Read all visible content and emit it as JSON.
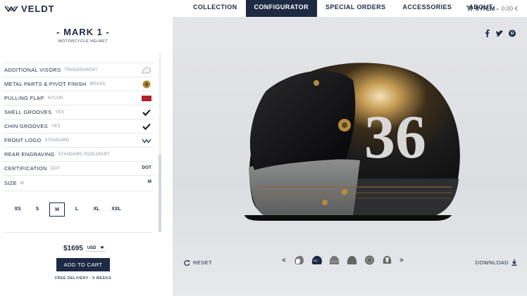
{
  "brand": {
    "name": "VELDT",
    "icon": "veldt-logo-icon"
  },
  "nav": {
    "items": [
      {
        "label": "COLLECTION",
        "active": false
      },
      {
        "label": "CONFIGURATOR",
        "active": true
      },
      {
        "label": "SPECIAL ORDERS",
        "active": false
      },
      {
        "label": "ACCESSORIES",
        "active": false
      },
      {
        "label": "ABOUT",
        "active": false
      }
    ],
    "cart_label": "0 ITEM -",
    "cart_price": "0,00 €",
    "cart_icon": "shopping-cart-icon"
  },
  "product": {
    "title": "- MARK 1 -",
    "subtitle": "MOTORCYCLE HELMET"
  },
  "options": [
    {
      "name": "ADDITIONAL VISORS",
      "value": "TRANSPARENT",
      "icon": "visor-icon"
    },
    {
      "name": "METAL PARTS & PIVOT FINISH",
      "value": "BRASS",
      "icon": "brass-swatch-icon"
    },
    {
      "name": "PULLING FLAP",
      "value": "NYLON",
      "icon": "red-flap-swatch-icon"
    },
    {
      "name": "SHELL GROOVES",
      "value": "YES",
      "icon": "checkmark-icon"
    },
    {
      "name": "CHIN GROOVES",
      "value": "YES",
      "icon": "checkmark-icon"
    },
    {
      "name": "FRONT LOGO",
      "value": "STANDARD",
      "icon": "veldt-logo-icon"
    },
    {
      "name": "REAR ENGRAVING",
      "value": "STANDARD RIDEAPART",
      "icon": ""
    },
    {
      "name": "CERTIFICATION",
      "value": "DOT",
      "badge": "DOT"
    },
    {
      "name": "SIZE",
      "value": "M",
      "badge": "M"
    }
  ],
  "sizes": {
    "items": [
      "XS",
      "S",
      "M",
      "L",
      "XL",
      "XXL"
    ],
    "selected": "M"
  },
  "pricing": {
    "price": "$1695",
    "currency": "USD",
    "add_to_cart": "ADD TO CART",
    "delivery": "FREE DELIVERY - 9 WEEKS"
  },
  "viewer": {
    "reset_label": "RESET",
    "download_label": "DOWNLOAD",
    "helmet_number": "36",
    "share_icons": [
      "facebook-icon",
      "twitter-icon",
      "pinterest-icon"
    ],
    "thumbnails": [
      "view-side-thumb",
      "view-front-thumb",
      "view-back-thumb",
      "view-top-thumb",
      "view-rear-thumb",
      "view-inside-thumb"
    ],
    "selected_thumbnail": "view-front-thumb"
  },
  "colors": {
    "navy": "#1d2a44",
    "brass": "#b48a3c",
    "flap_red": "#b0202a"
  }
}
